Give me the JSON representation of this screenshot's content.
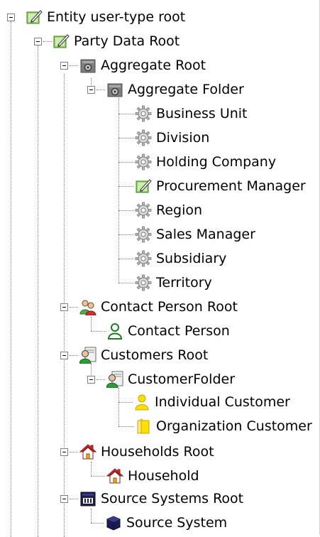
{
  "tree": {
    "root": {
      "label": "Entity user-type root",
      "icon": "edit-entity-icon"
    },
    "party": {
      "label": "Party Data Root",
      "icon": "edit-entity-icon"
    },
    "aggregate_root": {
      "label": "Aggregate Root",
      "icon": "aggregate-icon"
    },
    "aggregate_folder": {
      "label": "Aggregate Folder",
      "icon": "aggregate-icon"
    },
    "aggregate_items": [
      {
        "label": "Business Unit",
        "icon": "gear-icon"
      },
      {
        "label": "Division",
        "icon": "gear-icon"
      },
      {
        "label": "Holding Company",
        "icon": "gear-icon"
      },
      {
        "label": "Procurement Manager",
        "icon": "edit-entity-icon"
      },
      {
        "label": "Region",
        "icon": "gear-icon"
      },
      {
        "label": "Sales Manager",
        "icon": "gear-icon"
      },
      {
        "label": "Subsidiary",
        "icon": "gear-icon"
      },
      {
        "label": "Territory",
        "icon": "gear-icon"
      }
    ],
    "contact_root": {
      "label": "Contact Person Root",
      "icon": "contacts-icon"
    },
    "contact_person": {
      "label": "Contact Person",
      "icon": "person-icon"
    },
    "customers_root": {
      "label": "Customers Root",
      "icon": "customers-icon"
    },
    "customer_folder": {
      "label": "CustomerFolder",
      "icon": "customers-icon"
    },
    "individual_customer": {
      "label": "Individual Customer",
      "icon": "individual-icon"
    },
    "organization_customer": {
      "label": "Organization Customer",
      "icon": "organization-icon"
    },
    "households_root": {
      "label": "Households Root",
      "icon": "house-icon"
    },
    "household": {
      "label": "Household",
      "icon": "house-icon"
    },
    "source_root": {
      "label": "Source Systems Root",
      "icon": "source-system-icon"
    },
    "source_system": {
      "label": "Source System",
      "icon": "cube-icon"
    }
  }
}
